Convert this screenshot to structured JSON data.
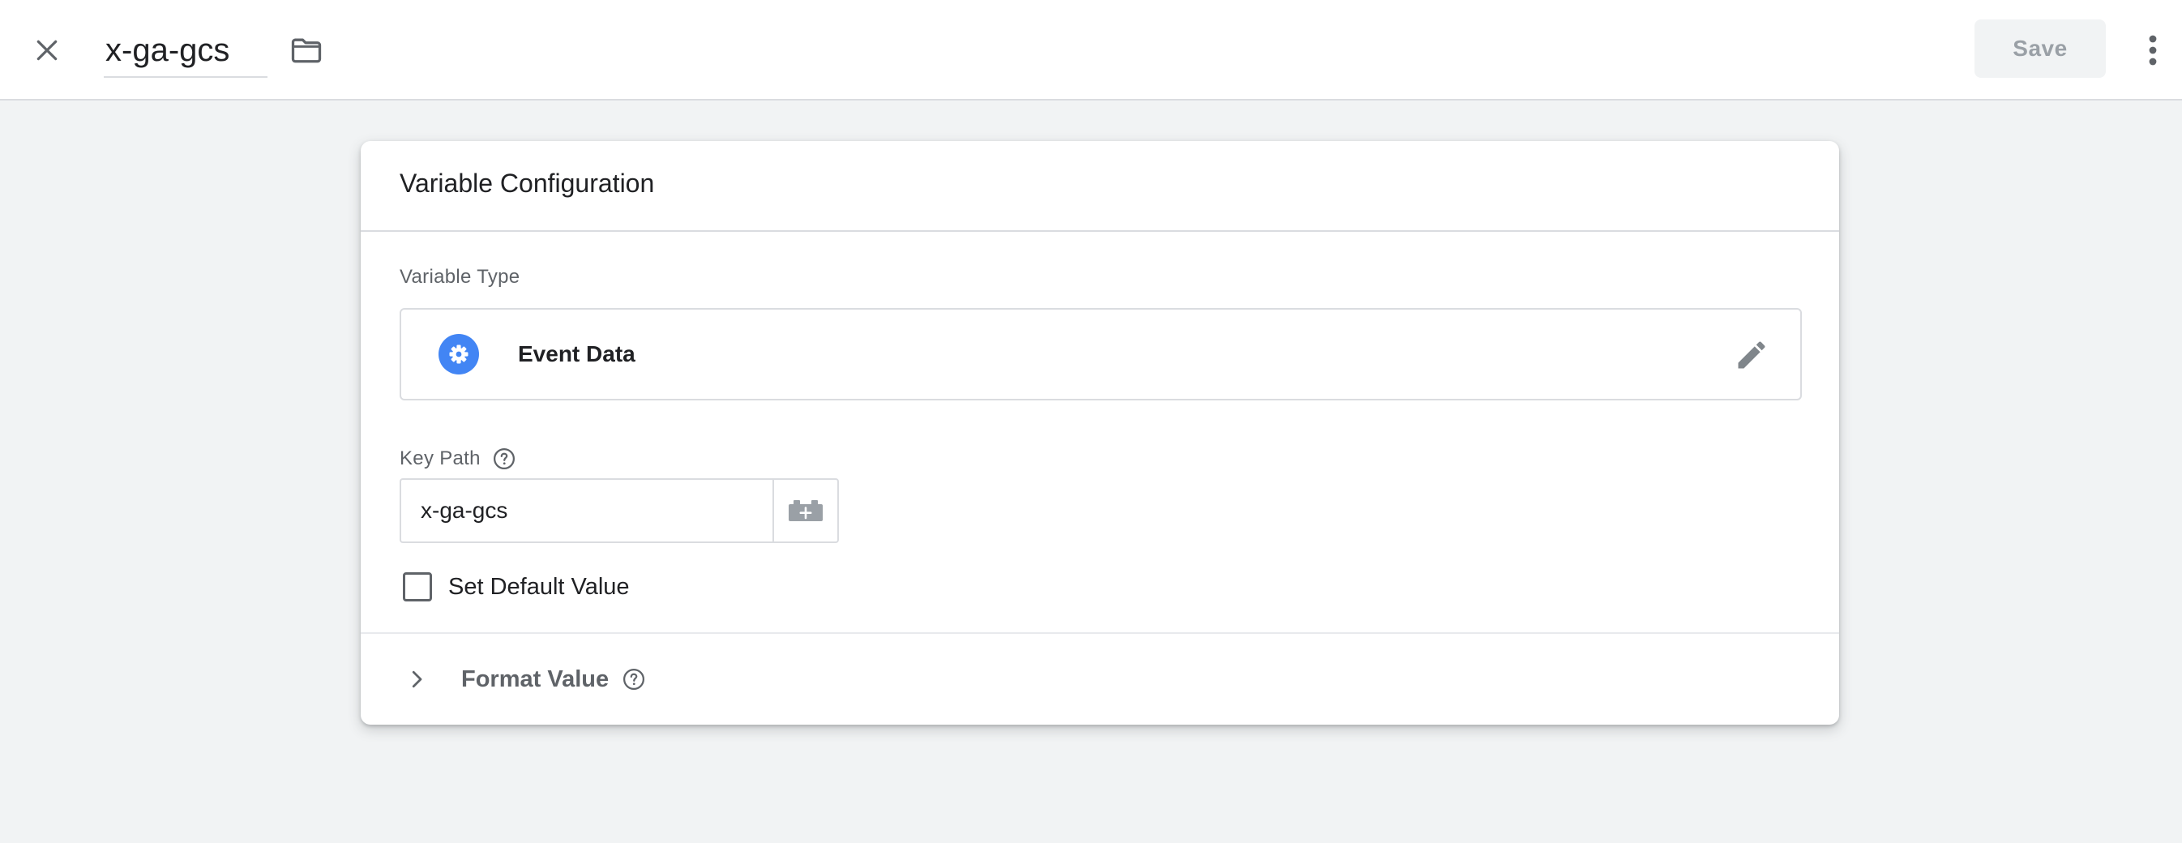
{
  "header": {
    "variable_name": "x-ga-gcs",
    "save_label": "Save",
    "icons": {
      "close": "close-icon",
      "folder": "folder-icon",
      "more": "more-vert-icon"
    }
  },
  "card": {
    "title": "Variable Configuration",
    "variable_type_label": "Variable Type",
    "variable_type": {
      "name": "Event Data",
      "icon": "gear-icon",
      "icon_color": "#4285f4",
      "edit_icon": "pencil-icon"
    },
    "key_path": {
      "label": "Key Path",
      "value": "x-ga-gcs",
      "picker_icon": "variable-picker-icon"
    },
    "default_value": {
      "label": "Set Default Value",
      "checked": false
    },
    "format_value": {
      "label": "Format Value",
      "expanded": false
    }
  }
}
